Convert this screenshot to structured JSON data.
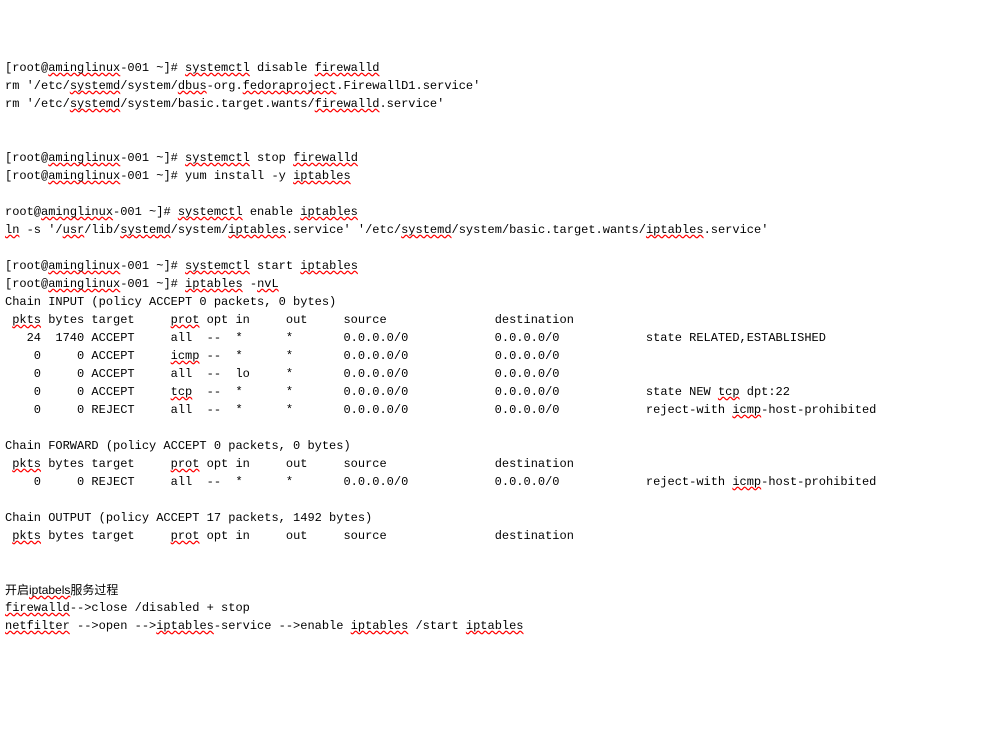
{
  "lines": {
    "l1_p1": "[root@",
    "l1_p2": "aminglinux",
    "l1_p3": "-001 ~]# ",
    "l1_p4": "systemctl",
    "l1_p5": " disable ",
    "l1_p6": "firewalld",
    "l2_p1": "rm '/etc/",
    "l2_p2": "systemd",
    "l2_p3": "/system/",
    "l2_p4": "dbus",
    "l2_p5": "-org.",
    "l2_p6": "fedoraproject",
    "l2_p7": ".FirewallD1.service'",
    "l3_p1": "rm '/etc/",
    "l3_p2": "systemd",
    "l3_p3": "/system/basic.target.wants/",
    "l3_p4": "firewalld",
    "l3_p5": ".service'",
    "l4_p1": "[root@",
    "l4_p2": "aminglinux",
    "l4_p3": "-001 ~]# ",
    "l4_p4": "systemctl",
    "l4_p5": " stop ",
    "l4_p6": "firewalld",
    "l5_p1": "[root@",
    "l5_p2": "aminglinux",
    "l5_p3": "-001 ~]# yum install -y ",
    "l5_p4": "iptables",
    "l6_p1": "root@",
    "l6_p2": "aminglinux",
    "l6_p3": "-001 ~]# ",
    "l6_p4": "systemctl",
    "l6_p5": " enable ",
    "l6_p6": "iptables",
    "l7_p1": "ln",
    "l7_p2": " -s '/",
    "l7_p3": "usr",
    "l7_p4": "/lib/",
    "l7_p5": "systemd",
    "l7_p6": "/system/",
    "l7_p7": "iptables",
    "l7_p8": ".service' '/etc/",
    "l7_p9": "systemd",
    "l7_p10": "/system/basic.target.wants/",
    "l7_p11": "iptables",
    "l7_p12": ".service'",
    "l8_p1": "[root@",
    "l8_p2": "aminglinux",
    "l8_p3": "-001 ~]# ",
    "l8_p4": "systemctl",
    "l8_p5": " start ",
    "l8_p6": "iptables",
    "l9_p1": "[root@",
    "l9_p2": "aminglinux",
    "l9_p3": "-001 ~]# ",
    "l9_p4": "iptables",
    "l9_p5": " -",
    "l9_p6": "nvL",
    "l10": "Chain INPUT (policy ACCEPT 0 packets, 0 bytes)",
    "l11_p1": " ",
    "l11_p2": "pkts",
    "l11_p3": " bytes target     ",
    "l11_p4": "prot",
    "l11_p5": " opt in     out     source               destination",
    "l12": "   24  1740 ACCEPT     all  --  *      *       0.0.0.0/0            0.0.0.0/0            state RELATED,ESTABLISHED",
    "l13_p1": "    0     0 ACCEPT     ",
    "l13_p2": "icmp",
    "l13_p3": " --  *      *       0.0.0.0/0            0.0.0.0/0",
    "l14": "    0     0 ACCEPT     all  --  lo     *       0.0.0.0/0            0.0.0.0/0",
    "l15_p1": "    0     0 ACCEPT     ",
    "l15_p2": "tcp",
    "l15_p3": "  --  *      *       0.0.0.0/0            0.0.0.0/0            state NEW ",
    "l15_p4": "tcp",
    "l15_p5": " dpt:22",
    "l16_p1": "    0     0 REJECT     all  --  *      *       0.0.0.0/0            0.0.0.0/0            reject-with ",
    "l16_p2": "icmp",
    "l16_p3": "-host-prohibited",
    "l17": "Chain FORWARD (policy ACCEPT 0 packets, 0 bytes)",
    "l18_p1": " ",
    "l18_p2": "pkts",
    "l18_p3": " bytes target     ",
    "l18_p4": "prot",
    "l18_p5": " opt in     out     source               destination",
    "l19_p1": "    0     0 REJECT     all  --  *      *       0.0.0.0/0            0.0.0.0/0            reject-with ",
    "l19_p2": "icmp",
    "l19_p3": "-host-prohibited",
    "l20": "Chain OUTPUT (policy ACCEPT 17 packets, 1492 bytes)",
    "l21_p1": " ",
    "l21_p2": "pkts",
    "l21_p3": " bytes target     ",
    "l21_p4": "prot",
    "l21_p5": " opt in     out     source               destination",
    "l22_p1": "开启",
    "l22_p2": "iptabels",
    "l22_p3": "服务过程",
    "l23_p1": "firewalld",
    "l23_p2": "-->close /disabled + stop",
    "l24_p1": "netfilter",
    "l24_p2": " -->open -->",
    "l24_p3": "iptables",
    "l24_p4": "-service -->enable ",
    "l24_p5": "iptables",
    "l24_p6": " /start ",
    "l24_p7": "iptables"
  }
}
